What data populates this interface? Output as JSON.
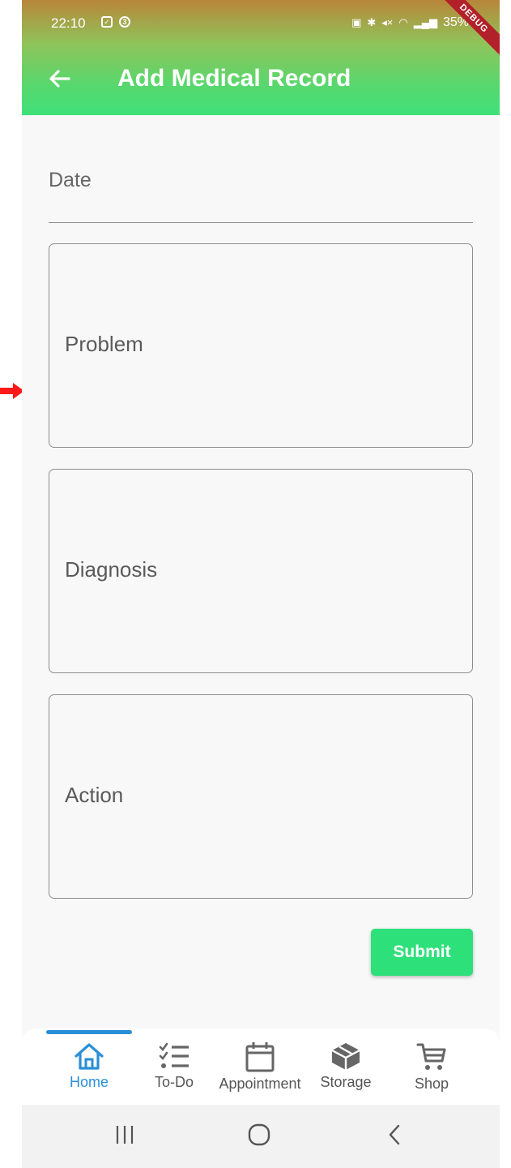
{
  "status_bar": {
    "time": "22:10",
    "battery": "35%",
    "debug_banner": "DEBUG"
  },
  "app_bar": {
    "title": "Add Medical Record",
    "back_icon": "arrow-left-icon"
  },
  "form": {
    "date_label": "Date",
    "problem_label": "Problem",
    "diagnosis_label": "Diagnosis",
    "action_label": "Action",
    "submit_label": "Submit"
  },
  "bottom_nav": {
    "items": [
      {
        "label": "Home",
        "icon": "home-icon",
        "active": true
      },
      {
        "label": "To-Do",
        "icon": "checklist-icon",
        "active": false
      },
      {
        "label": "Appointment",
        "icon": "calendar-icon",
        "active": false
      },
      {
        "label": "Storage",
        "icon": "box-icon",
        "active": false
      },
      {
        "label": "Shop",
        "icon": "cart-icon",
        "active": false
      }
    ]
  },
  "colors": {
    "accent": "#2a8fd6",
    "submit": "#2ee07a",
    "header_green": "#3fe07a",
    "annotation_arrow": "#ff0000"
  }
}
